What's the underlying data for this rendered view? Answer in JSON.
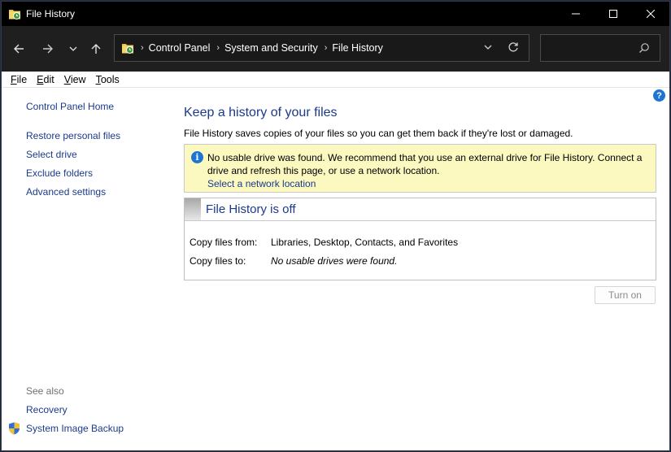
{
  "window": {
    "title": "File History"
  },
  "navbar": {
    "breadcrumbs": [
      "Control Panel",
      "System and Security",
      "File History"
    ],
    "search": {
      "value": "",
      "placeholder": ""
    }
  },
  "menu": {
    "items": [
      {
        "label": "File",
        "u": "F",
        "rest": "ile"
      },
      {
        "label": "Edit",
        "u": "E",
        "rest": "dit"
      },
      {
        "label": "View",
        "u": "V",
        "rest": "iew"
      },
      {
        "label": "Tools",
        "u": "T",
        "rest": "ools"
      }
    ]
  },
  "sidebar": {
    "home": "Control Panel Home",
    "links": [
      "Restore personal files",
      "Select drive",
      "Exclude folders",
      "Advanced settings"
    ],
    "see_also_label": "See also",
    "see_also": [
      "Recovery",
      "System Image Backup"
    ]
  },
  "main": {
    "heading": "Keep a history of your files",
    "description": "File History saves copies of your files so you can get them back if they're lost or damaged.",
    "info": {
      "message": "No usable drive was found. We recommend that you use an external drive for File History. Connect a drive and refresh this page, or use a network location.",
      "link": "Select a network location"
    },
    "status": {
      "title": "File History is off",
      "copy_from_label": "Copy files from:",
      "copy_from_value": "Libraries, Desktop, Contacts, and Favorites",
      "copy_to_label": "Copy files to:",
      "copy_to_value": "No usable drives were found."
    },
    "turn_on_label": "Turn on"
  },
  "colors": {
    "link": "#1a3a8c",
    "info_background": "#fbf8c0",
    "titlebar": "#000000",
    "navbar": "#1f1f1f"
  },
  "icons": [
    "file-history-icon",
    "minimize-icon",
    "maximize-icon",
    "close-icon",
    "back-arrow-icon",
    "forward-arrow-icon",
    "recent-locations-icon",
    "up-arrow-icon",
    "chevron-down-icon",
    "refresh-icon",
    "search-icon",
    "help-icon",
    "info-icon",
    "shield-icon"
  ]
}
